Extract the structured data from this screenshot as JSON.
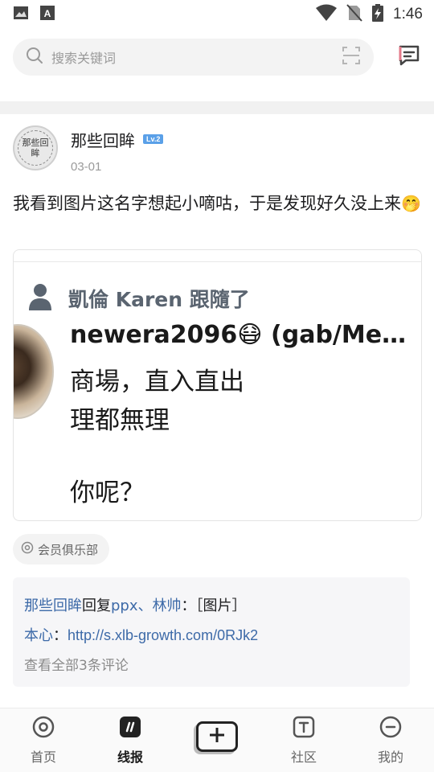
{
  "status_bar": {
    "time": "1:46",
    "icons": [
      "image-icon",
      "a-icon",
      "wifi-icon",
      "no-sim-icon",
      "battery-charging-icon"
    ]
  },
  "search": {
    "placeholder": "搜索关键词",
    "icons": [
      "search-icon",
      "scan-icon",
      "message-icon"
    ]
  },
  "post": {
    "author": "那些回眸",
    "avatar_text": "那些回眸",
    "level": "Lv.2",
    "date": "03-01",
    "text": "我看到图片这名字想起小嘀咕，于是发现好久没上来",
    "emoji": "🤭",
    "image": {
      "follow_text": "凱倫 Karen 跟隨了",
      "handle": "newera2096😷 (gab/Me…",
      "lines": [
        "商場，直入直出",
        "理都無理",
        "你呢？"
      ]
    },
    "tag": "会员俱乐部",
    "comments": [
      {
        "user": "那些回眸",
        "reply_word": "回复",
        "target": "ppx、林帅",
        "sep": "：",
        "text": "［图片］"
      },
      {
        "user": "本心",
        "sep": "：",
        "link": "http://s.xlb-growth.com/0RJk2"
      }
    ],
    "view_all": "查看全部3条评论"
  },
  "bottom_nav": {
    "items": [
      {
        "label": "首页",
        "icon": "home-circle-icon",
        "active": false
      },
      {
        "label": "线报",
        "icon": "news-icon",
        "active": true
      },
      {
        "label": "",
        "icon": "add-icon",
        "active": false
      },
      {
        "label": "社区",
        "icon": "community-icon",
        "active": false
      },
      {
        "label": "我的",
        "icon": "profile-icon",
        "active": false
      }
    ]
  }
}
